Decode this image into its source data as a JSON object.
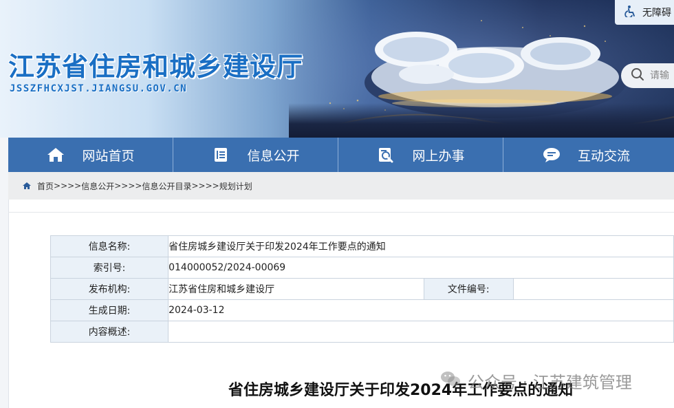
{
  "header": {
    "site_title": "江苏省住房和城乡建设厅",
    "site_domain": "JSSZFHCXJST.JIANGSU.GOV.CN",
    "accessibility_label": "无障碍",
    "search_placeholder": "请输"
  },
  "nav": {
    "items": [
      {
        "label": "网站首页",
        "icon": "home-icon"
      },
      {
        "label": "信息公开",
        "icon": "document-icon"
      },
      {
        "label": "网上办事",
        "icon": "search-service-icon"
      },
      {
        "label": "互动交流",
        "icon": "chat-icon"
      }
    ]
  },
  "breadcrumb": {
    "items": [
      "首页",
      "信息公开",
      "信息公开目录",
      "规划计划"
    ],
    "separator": ">>"
  },
  "meta": {
    "name_label": "信息名称:",
    "name_value": "省住房城乡建设厅关于印发2024年工作要点的通知",
    "index_label": "索引号:",
    "index_value": "014000052/2024-00069",
    "publisher_label": "发布机构:",
    "publisher_value": "江苏省住房和城乡建设厅",
    "doc_no_label": "文件编号:",
    "doc_no_value": "",
    "date_label": "生成日期:",
    "date_value": "2024-03-12",
    "summary_label": "内容概述:",
    "summary_value": ""
  },
  "document": {
    "title": "省住房城乡建设厅关于印发2024年工作要点的通知"
  },
  "watermark": {
    "text": "公众号 · 江苏建筑管理"
  },
  "colors": {
    "nav_bg": "#3a6fb0",
    "title_blue": "#1a6fc4",
    "label_cell_bg": "#eaf1f8"
  }
}
